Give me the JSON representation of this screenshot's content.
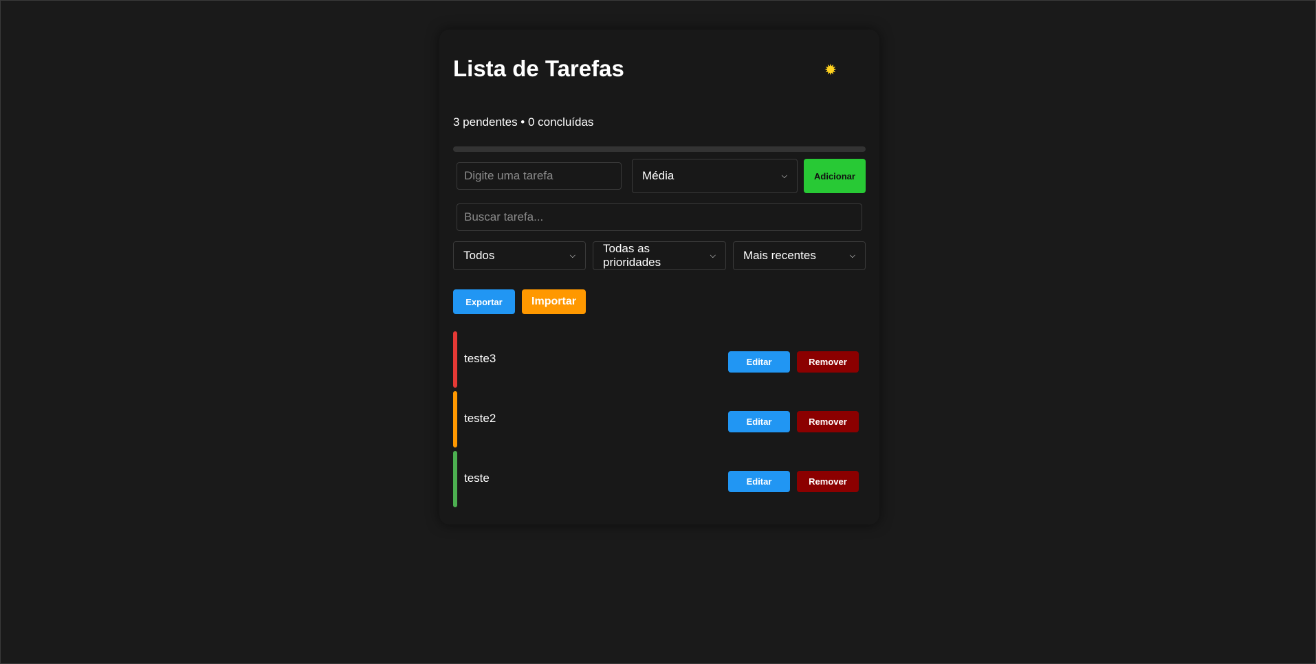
{
  "app": {
    "title": "Lista de Tarefas",
    "theme_icon": "sun-icon",
    "theme_glyph": "✹"
  },
  "stats": {
    "text": "3 pendentes • 0 concluídas",
    "pending": 3,
    "completed": 0,
    "progress_fraction": 0
  },
  "form": {
    "task_placeholder": "Digite uma tarefa",
    "priority_selected": "Média",
    "add_label": "Adicionar"
  },
  "search": {
    "placeholder": "Buscar tarefa..."
  },
  "filters": {
    "status_selected": "Todos",
    "priority_selected": "Todas as prioridades",
    "sort_selected": "Mais recentes"
  },
  "actions": {
    "export_label": "Exportar",
    "import_label": "Importar"
  },
  "tasks": [
    {
      "text": "teste3",
      "priority_color": "#e53935",
      "edit_label": "Editar",
      "remove_label": "Remover"
    },
    {
      "text": "teste2",
      "priority_color": "#ff9800",
      "edit_label": "Editar",
      "remove_label": "Remover"
    },
    {
      "text": "teste",
      "priority_color": "#4caf50",
      "edit_label": "Editar",
      "remove_label": "Remover"
    }
  ],
  "colors": {
    "background": "#1a1a1a",
    "card": "#181818",
    "add_button": "#28c935",
    "export_button": "#2196f3",
    "import_button": "#ff9800",
    "edit_button": "#2196f3",
    "remove_button": "#8b0000",
    "theme_icon": "#ffd21f"
  }
}
